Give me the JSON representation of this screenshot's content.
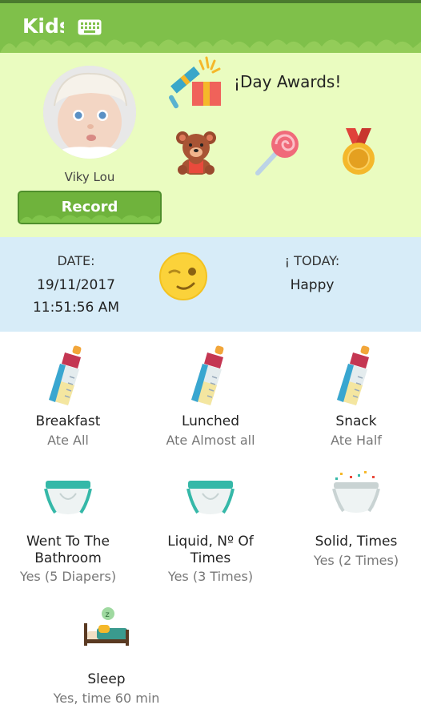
{
  "app": {
    "title": "Kids",
    "keyboard_icon": "keyboard-icon"
  },
  "profile": {
    "name": "Viky Lou",
    "record_label": "Record"
  },
  "awards": {
    "title": "¡Day Awards!",
    "items": [
      "teddy-bear-icon",
      "lollipop-icon",
      "medal-icon"
    ]
  },
  "date": {
    "label": "DATE:",
    "date": "19/11/2017",
    "time": "11:51:56 AM",
    "today_label": "¡ TODAY:",
    "mood": "Happy"
  },
  "activities": [
    {
      "name": "Breakfast",
      "value": "Ate All",
      "icon": "baby-bottle-icon"
    },
    {
      "name": "Lunched",
      "value": "Ate Almost all",
      "icon": "baby-bottle-icon"
    },
    {
      "name": "Snack",
      "value": "Ate Half",
      "icon": "baby-bottle-icon"
    },
    {
      "name_line1": "Went To The",
      "name_line2": "Bathroom",
      "value": "Yes (5 Diapers)",
      "icon": "diaper-icon"
    },
    {
      "name_line1": "Liquid, Nº Of",
      "name_line2": "Times",
      "value": "Yes (3 Times)",
      "icon": "diaper-icon"
    },
    {
      "name": "Solid, Times",
      "value": "Yes (2 Times)",
      "icon": "diaper-icon"
    },
    {
      "name": "Sleep",
      "value": "Yes, time 60 min",
      "icon": "sleep-bed-icon"
    }
  ],
  "colors": {
    "header": "#7fc04a",
    "profile_bg": "#eafcc0",
    "date_bg": "#d7ecf8",
    "button": "#6fb33c"
  }
}
